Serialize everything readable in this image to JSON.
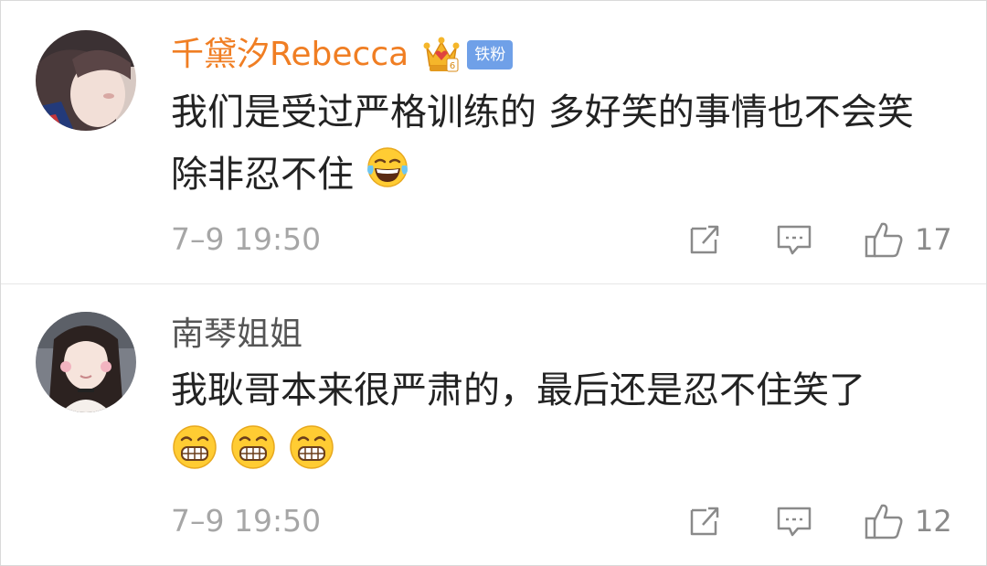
{
  "comments": [
    {
      "username": "千黛汐Rebecca",
      "badge": "铁粉",
      "content": "我们是受过严格训练的 多好笑的事情也不会笑 除非忍不住",
      "timestamp": "7–9 19:50",
      "likes": "17",
      "emoji": [
        "laugh-cry-emoji"
      ]
    },
    {
      "username": "南琴姐姐",
      "content": "我耿哥本来很严肃的，最后还是忍不住笑了",
      "timestamp": "7–9 19:50",
      "likes": "12",
      "emoji": [
        "grin-emoji",
        "grin-emoji",
        "grin-emoji"
      ]
    }
  ],
  "icons": {
    "repost": "repost-icon",
    "comment": "comment-icon",
    "like": "thumbs-up-icon",
    "vip": "crown-icon"
  },
  "colors": {
    "vip_name": "#f07e23",
    "normal_name": "#555555",
    "badge_bg": "#6fa0e8",
    "meta_text": "#a6a6a6",
    "divider": "#e6e6e6"
  }
}
